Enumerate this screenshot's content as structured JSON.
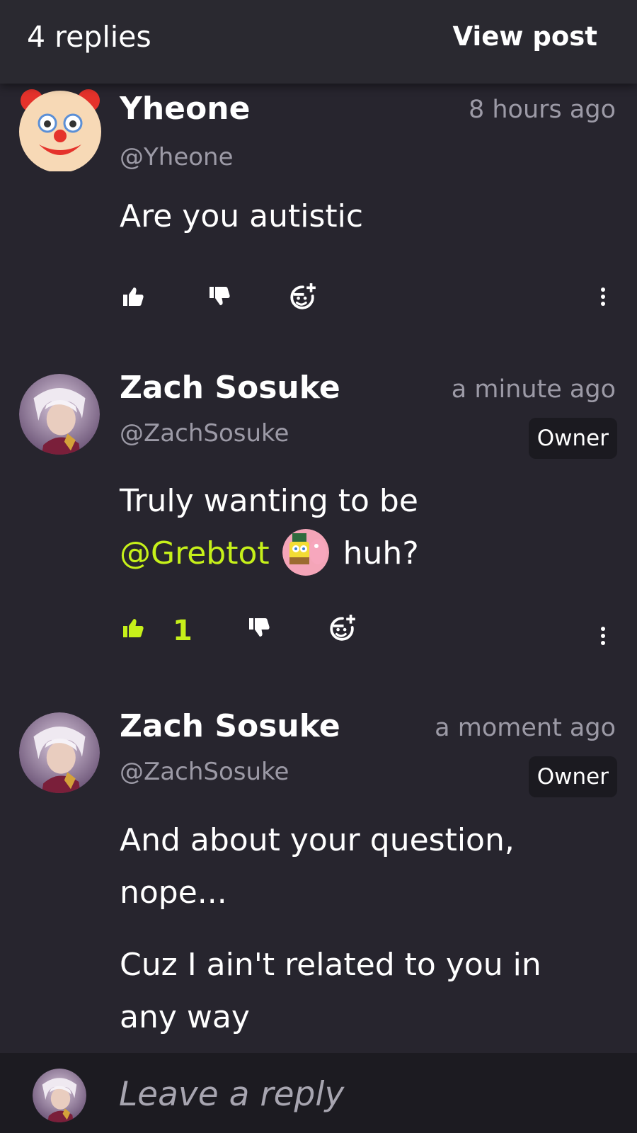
{
  "header": {
    "replies_label": "4 replies",
    "view_post_label": "View post"
  },
  "comments": [
    {
      "name": "Yheone",
      "handle": "@Yheone",
      "time": "8 hours ago",
      "avatar_icon": "clown-face-emoji",
      "body": "Are you autistic",
      "likes": ""
    },
    {
      "name": "Zach Sosuke",
      "handle": "@ZachSosuke",
      "time": "a minute ago",
      "badge": "Owner",
      "avatar_icon": "anime-character-avatar",
      "body_line1": "Truly wanting to be",
      "mention": "@Grebtot",
      "body_line2_end": "huh?",
      "likes": "1"
    },
    {
      "name": "Zach Sosuke",
      "handle": "@ZachSosuke",
      "time": "a moment ago",
      "badge": "Owner",
      "avatar_icon": "anime-character-avatar",
      "body_para1": "And about your question, nope...",
      "body_para2": "Cuz I ain't related to you in any way"
    }
  ],
  "reply_bar": {
    "placeholder": "Leave a reply"
  },
  "colors": {
    "background": "#27252e",
    "accent": "#c6f01a",
    "muted": "#9c9aa6"
  }
}
